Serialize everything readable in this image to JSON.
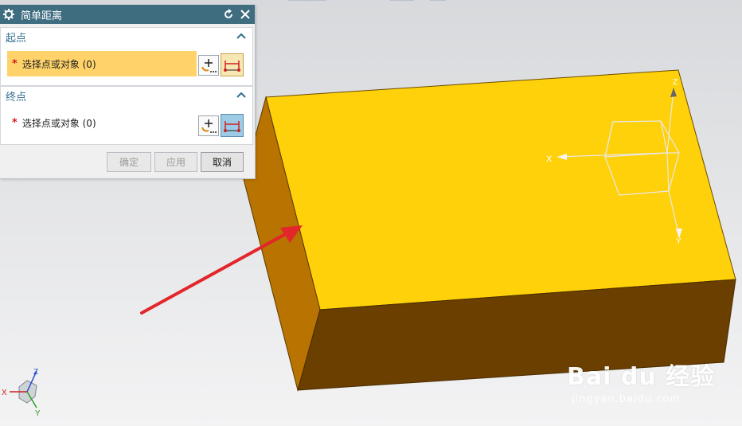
{
  "dialog": {
    "title": "简单距离",
    "icons": {
      "settings": "gear-icon",
      "reset": "reset-icon",
      "close": "close-icon"
    },
    "start_section": {
      "label": "起点",
      "select_label": "选择点或对象 (0)",
      "required_mark": "*"
    },
    "end_section": {
      "label": "终点",
      "select_label": "选择点或对象 (0)",
      "required_mark": "*"
    },
    "buttons": {
      "ok": "确定",
      "apply": "应用",
      "cancel": "取消"
    }
  },
  "viewport": {
    "csys_labels": {
      "x": "X",
      "y": "Y",
      "z": "Z"
    },
    "triad_labels": {
      "x": "X",
      "y": "Y",
      "z": "Z"
    }
  },
  "watermark": {
    "brand": "Bai du 经验",
    "url": "jingyan.baidu.com"
  },
  "colors": {
    "titlebar": "#3f6d80",
    "highlight_row": "#ffd36a",
    "box_top": "#ffd10a",
    "box_left": "#b87300",
    "box_front": "#6a3f00",
    "arrow": "#e2262a"
  }
}
